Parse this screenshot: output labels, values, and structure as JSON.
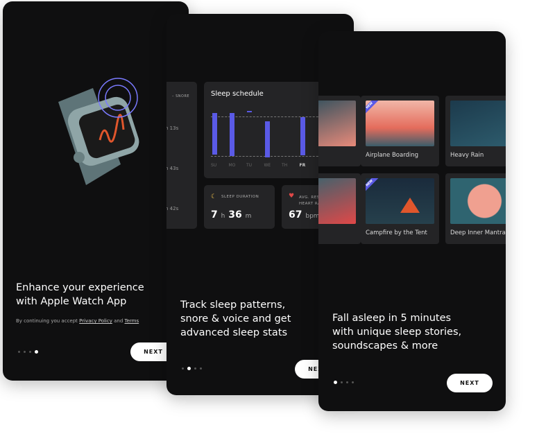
{
  "screens": [
    {
      "title_line1": "Enhance your experience",
      "title_line2": "with Apple Watch App",
      "consent_prefix": "By continuing you accept ",
      "privacy_link": "Privacy Policy",
      "consent_and": " and ",
      "terms_link": "Terms",
      "next": "NEXT",
      "active_dot": 3
    },
    {
      "title_line1": "Track sleep patterns,",
      "title_line2": "snore & voice and get",
      "title_line3": "advanced sleep stats",
      "next": "NEXT",
      "active_dot": 1,
      "left_panel": {
        "legend": "– SNORE",
        "durations": [
          "n 13s",
          "n 43s",
          "n 42s"
        ]
      },
      "schedule": {
        "title": "Sleep schedule",
        "days": [
          "SU",
          "MO",
          "TU",
          "WE",
          "TH",
          "FR"
        ],
        "active_day": "FR"
      },
      "sleep_duration": {
        "label": "SLEEP DURATION",
        "hours": "7",
        "h": "h",
        "minutes": "36",
        "m": "m"
      },
      "heart_rate": {
        "label_line1": "AVG. REST",
        "label_line2": "HEART RA",
        "value": "67",
        "unit": "bpm"
      }
    },
    {
      "title_line1": "Fall asleep in 5 minutes",
      "title_line2": "with unique sleep stories,",
      "title_line3": "soundscapes & more",
      "next": "NEXT",
      "active_dot": 0,
      "tiles": [
        {
          "label": "h",
          "new": false
        },
        {
          "label": "Airplane Boarding",
          "new": true
        },
        {
          "label": "Heavy Rain",
          "new": false
        },
        {
          "label": "",
          "new": false
        },
        {
          "label": "Campfire by the Tent",
          "new": true
        },
        {
          "label": "Deep Inner Mantra",
          "new": false
        }
      ],
      "new_badge": "NEW"
    }
  ],
  "colors": {
    "accent": "#5a5ae6",
    "card": "#0f0f10",
    "panel": "#242426",
    "orange": "#e0562c"
  }
}
